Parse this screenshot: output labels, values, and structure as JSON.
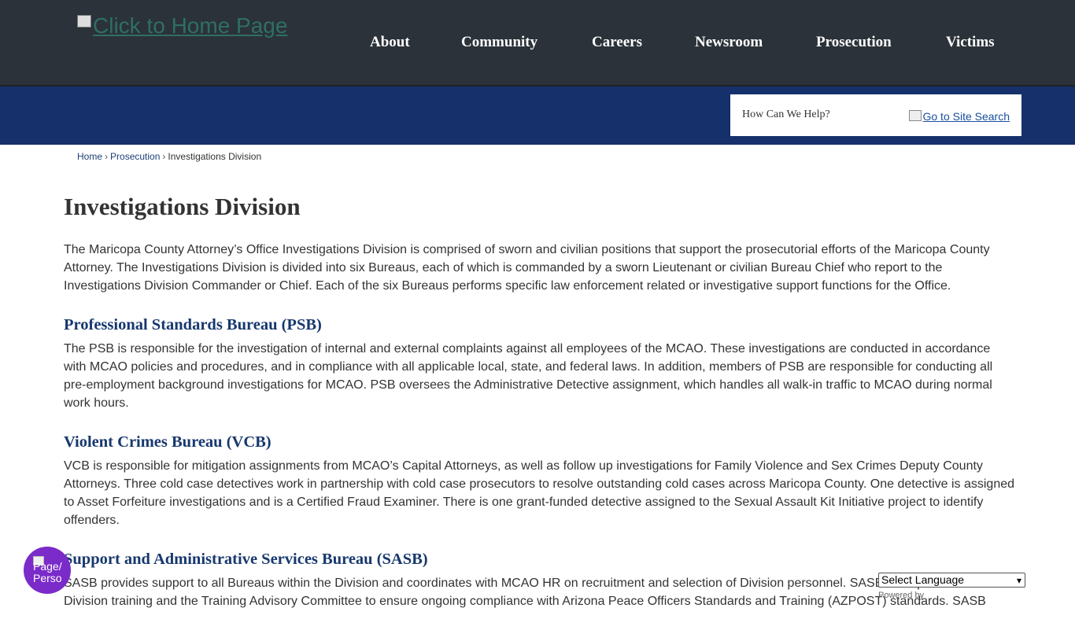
{
  "header": {
    "logo_text": "Click to Home Page",
    "nav": [
      "About",
      "Community",
      "Careers",
      "Newsroom",
      "Prosecution",
      "Victims"
    ]
  },
  "search": {
    "placeholder": "How Can We Help?",
    "button_alt": "Go to Site Search"
  },
  "breadcrumb": [
    "Home",
    "Prosecution",
    "Investigations Division"
  ],
  "page": {
    "title": "Investigations Division",
    "intro": "The Maricopa County Attorney’s Office Investigations Division is comprised of sworn and civilian positions that support the prosecutorial efforts of the Maricopa County Attorney. The Investigations Division is divided into six Bureaus, each of which is commanded by a sworn Lieutenant or civilian Bureau Chief who report to the Investigations Division Commander or Chief. Each of the six Bureaus performs specific law enforcement related or investigative support functions for the Office.",
    "sections": [
      {
        "heading": "Professional Standards Bureau (PSB)",
        "body": "The PSB is responsible for the investigation of internal and external complaints against all employees of the MCAO. These investigations are conducted in accordance with MCAO policies and procedures, and in compliance with all applicable local, state, and federal laws. In addition, members of PSB are responsible for conducting all pre-employment background investigations for MCAO. PSB oversees the Administrative Detective assignment, which handles all walk-in traffic to MCAO during normal work hours."
      },
      {
        "heading": "Violent Crimes Bureau (VCB)",
        "body": "VCB is responsible for mitigation assignments from MCAO’s Capital Attorneys, as well as follow up investigations for Family Violence and Sex Crimes Deputy County Attorneys. Three cold case detectives work in partnership with cold case prosecutors to resolve outstanding cold cases across Maricopa County. One detective is assigned to Asset Forfeiture investigations and is a Certified Fraud Examiner. There is one grant-funded detective assigned to the Sexual Assault Kit Initiative project to identify offenders."
      },
      {
        "heading": "Support and Administrative Services Bureau (SASB)",
        "body": "SASB provides support to all Bureaus within the Division and coordinates with MCAO HR on recruitment and selection of Division personnel. SASB is responsible for Division training and the Training Advisory Committee to ensure ongoing compliance with Arizona Peace Officers Standards and Training (AZPOST) standards. SASB"
      }
    ]
  },
  "widgets": {
    "accessibility_label": "Page/ Perso",
    "language_select": "Select Language",
    "powered_by": "Powered by"
  }
}
